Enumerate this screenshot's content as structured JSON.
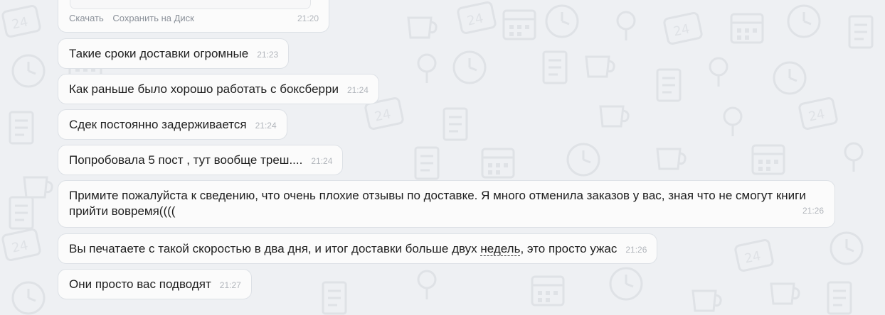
{
  "file_message": {
    "download_label": "Скачать",
    "save_to_disk_label": "Сохранить на Диск",
    "time": "21:20"
  },
  "messages": [
    {
      "text": "Такие сроки доставки огромные",
      "time": "21:23"
    },
    {
      "text": "Как раньше было хорошо работать с боксберри",
      "time": "21:24"
    },
    {
      "text": "Сдек постоянно задерживается",
      "time": "21:24"
    },
    {
      "text": "Попробовала 5 пост , тут вообще треш....",
      "time": "21:24"
    },
    {
      "text": "Примите пожалуйста к сведению, что очень плохие отзывы по доставке. Я много отменила заказов у вас, зная что не смогут книги прийти вовремя((((",
      "time": "21:26"
    },
    {
      "text_before": "Вы печатаете с такой скоростью в два дня, и итог доставки больше двух ",
      "text_underlined": "недель",
      "text_after": ", это просто ужас",
      "time": "21:26"
    },
    {
      "text": "Они просто вас подводят",
      "time": "21:27"
    }
  ],
  "colors": {
    "background": "#eef0f3",
    "bubble": "#fbfbfb",
    "bubble_border": "#dde1e6",
    "time": "#b2b6bc",
    "doodle": "#dfe2e6"
  }
}
